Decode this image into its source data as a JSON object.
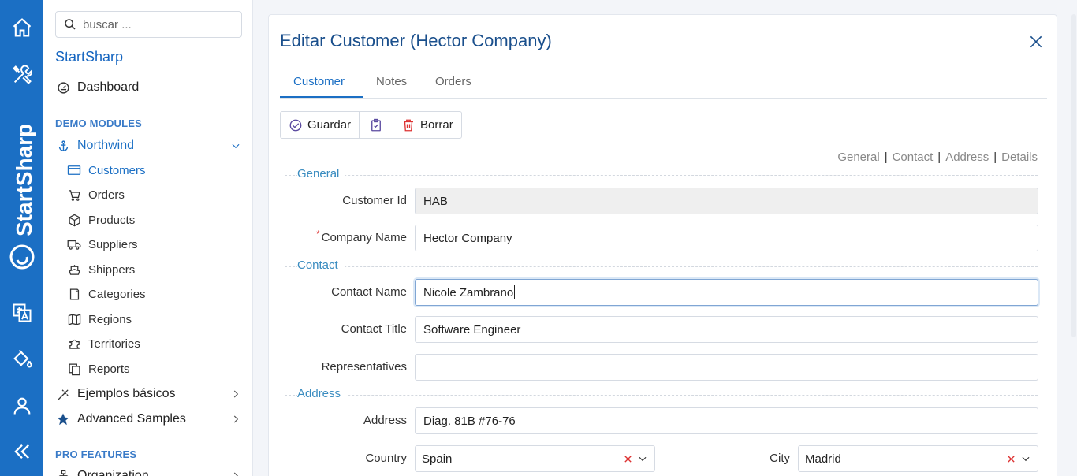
{
  "rail": {
    "brand_text": "StartSharp",
    "icons": [
      "home-icon",
      "tools-icon",
      "translate-icon",
      "paint-bucket-icon",
      "user-icon",
      "collapse-icon"
    ]
  },
  "sidebar": {
    "search_placeholder": "buscar ...",
    "app_title": "StartSharp",
    "dashboard": "Dashboard",
    "demo_modules": "DEMO MODULES",
    "northwind": "Northwind",
    "northwind_items": [
      {
        "label": "Customers",
        "icon": "card-icon"
      },
      {
        "label": "Orders",
        "icon": "cart-icon"
      },
      {
        "label": "Products",
        "icon": "box-icon"
      },
      {
        "label": "Suppliers",
        "icon": "truck-icon"
      },
      {
        "label": "Shippers",
        "icon": "ship-icon"
      },
      {
        "label": "Categories",
        "icon": "folder-icon"
      },
      {
        "label": "Regions",
        "icon": "map-icon"
      },
      {
        "label": "Territories",
        "icon": "puzzle-icon"
      },
      {
        "label": "Reports",
        "icon": "copy-icon"
      }
    ],
    "basic_samples": "Ejemplos básicos",
    "advanced_samples": "Advanced Samples",
    "pro_features": "PRO FEATURES",
    "organization": "Organization"
  },
  "dialog": {
    "title": "Editar Customer (Hector Company)",
    "tabs": [
      "Customer",
      "Notes",
      "Orders"
    ],
    "toolbar": {
      "save": "Guardar",
      "delete": "Borrar"
    },
    "category_links": [
      "General",
      "Contact",
      "Address",
      "Details"
    ],
    "categories": {
      "general": "General",
      "contact": "Contact",
      "address": "Address"
    },
    "fields": {
      "customer_id": {
        "label": "Customer Id",
        "value": "HAB"
      },
      "company_name": {
        "label": "Company Name",
        "value": "Hector Company",
        "required": "*"
      },
      "contact_name": {
        "label": "Contact Name",
        "value": "Nicole Zambrano"
      },
      "contact_title": {
        "label": "Contact Title",
        "value": "Software Engineer"
      },
      "representatives": {
        "label": "Representatives",
        "value": ""
      },
      "address": {
        "label": "Address",
        "value": "Diag. 81B #76-76"
      },
      "country": {
        "label": "Country",
        "value": "Spain"
      },
      "city": {
        "label": "City",
        "value": "Madrid"
      }
    }
  },
  "colors": {
    "rail": "#1b6fc4",
    "accent": "#1b6fc4",
    "category": "#3a8cc0",
    "title": "#1a4f8c"
  }
}
